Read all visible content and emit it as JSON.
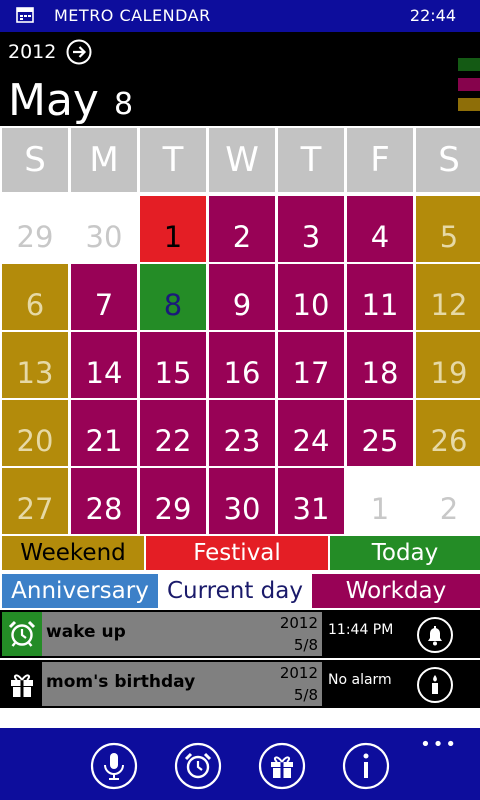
{
  "status_bar": {
    "title": "METRO CALENDAR",
    "time": "22:44"
  },
  "header": {
    "year": "2012",
    "month": "May",
    "day": "8"
  },
  "weekdays": [
    "S",
    "M",
    "T",
    "W",
    "T",
    "F",
    "S"
  ],
  "calendar": [
    [
      "29",
      "30",
      "1",
      "2",
      "3",
      "4",
      "5"
    ],
    [
      "6",
      "7",
      "8",
      "9",
      "10",
      "11",
      "12"
    ],
    [
      "13",
      "14",
      "15",
      "16",
      "17",
      "18",
      "19"
    ],
    [
      "20",
      "21",
      "22",
      "23",
      "24",
      "25",
      "26"
    ],
    [
      "27",
      "28",
      "29",
      "30",
      "31",
      "1",
      "2"
    ]
  ],
  "legend": {
    "weekend": "Weekend",
    "festival": "Festival",
    "today": "Today",
    "anniversary": "Anniversary",
    "current_day": "Current day",
    "workday": "Workday"
  },
  "events": [
    {
      "title": "wake up",
      "year": "2012",
      "date": "5/8",
      "status": "11:44 PM"
    },
    {
      "title": "mom's birthday",
      "year": "2012",
      "date": "5/8",
      "status": "No alarm"
    }
  ],
  "colors": {
    "weekend": "#b38b0b",
    "festival": "#e41e25",
    "today": "#248c26",
    "anniversary": "#3c80c8",
    "workday": "#980256",
    "header_gray": "#c3c3c3",
    "bar_blue": "#0d0d9c"
  },
  "icons": {
    "status": "calendar-app-icon",
    "next": "arrow-right-circle-icon",
    "event_alarm": "alarm-clock-icon",
    "event_gift": "gift-icon",
    "bell": "bell-icon",
    "candle": "candle-icon",
    "appbar": [
      "microphone-icon",
      "alarm-clock-icon",
      "gift-icon",
      "info-icon"
    ]
  }
}
